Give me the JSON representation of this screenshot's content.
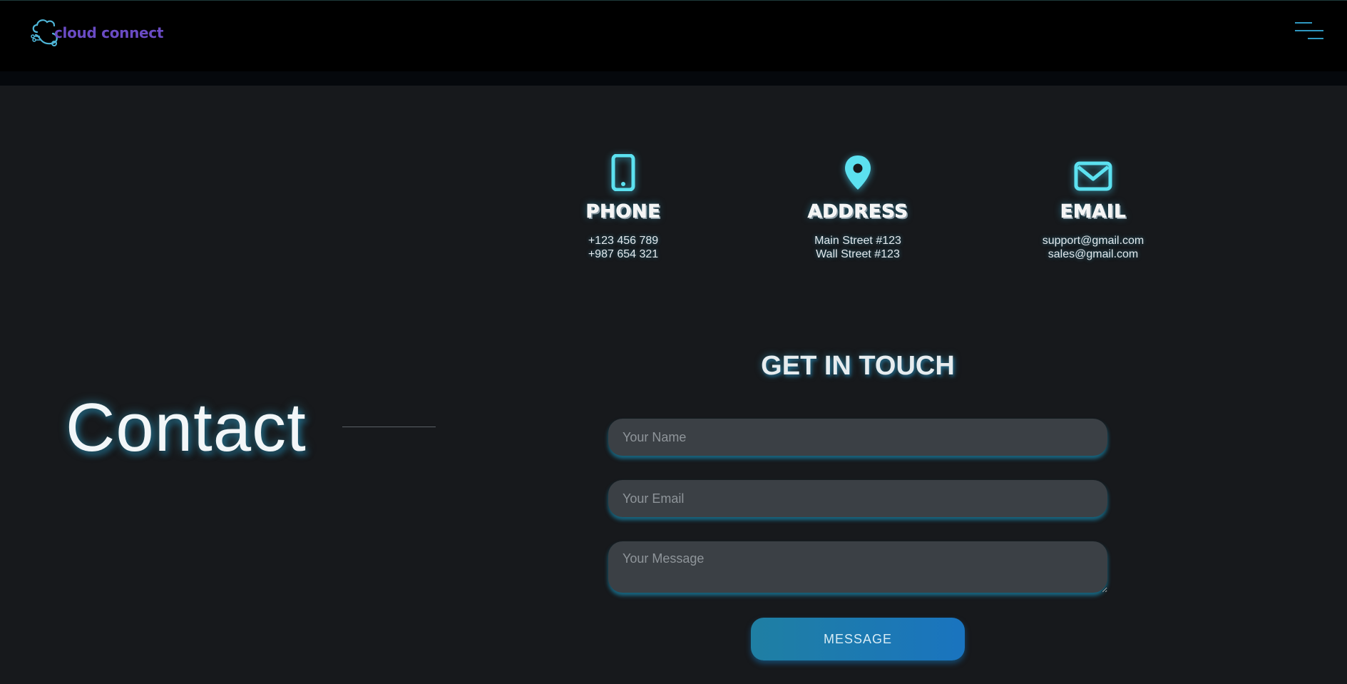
{
  "header": {
    "logo_text": "cloud connect",
    "menu_icon": "hamburger-menu-icon"
  },
  "hero": {
    "title": "Contact"
  },
  "contact_info": [
    {
      "icon": "phone-icon",
      "label": "PHONE",
      "lines": [
        "+123 456 789",
        "+987 654 321"
      ]
    },
    {
      "icon": "map-pin-icon",
      "label": "ADDRESS",
      "lines": [
        "Main Street #123",
        "Wall Street #123"
      ]
    },
    {
      "icon": "envelope-icon",
      "label": "EMAIL",
      "lines": [
        "support@gmail.com",
        "sales@gmail.com"
      ]
    }
  ],
  "form": {
    "title": "GET IN TOUCH",
    "name_placeholder": "Your Name",
    "email_placeholder": "Your Email",
    "message_placeholder": "Your Message",
    "submit_label": "MESSAGE"
  },
  "colors": {
    "accent": "#5ce1f0",
    "logo": "#6a4bc4",
    "button": "#1a74bf",
    "background": "#17191c",
    "navbar": "#000000"
  }
}
